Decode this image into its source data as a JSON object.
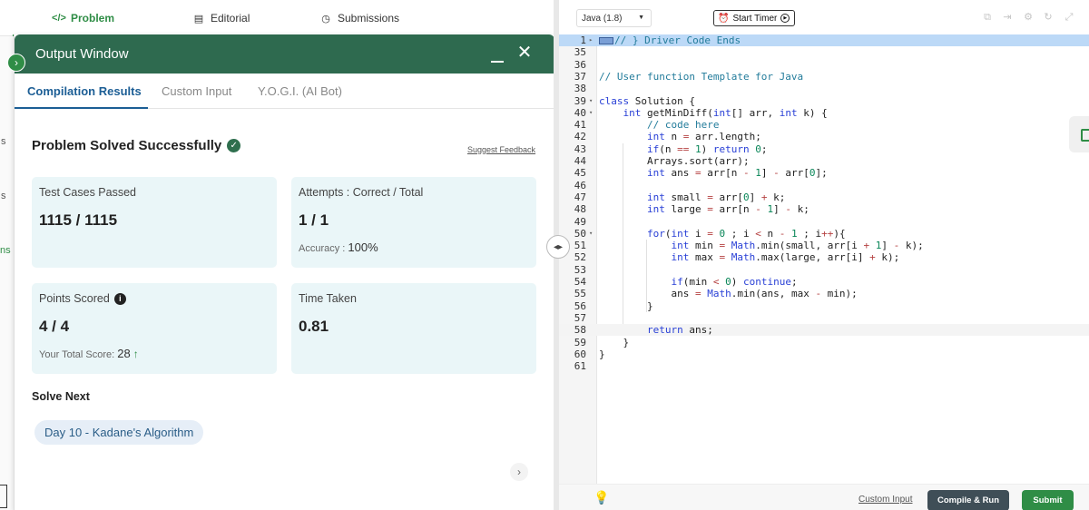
{
  "top_tabs": {
    "problem": "Problem",
    "editorial": "Editorial",
    "submissions": "Submissions"
  },
  "background_fragments": [
    "s",
    "s",
    "ns"
  ],
  "output_window": {
    "title": "Output Window",
    "tabs": [
      "Compilation Results",
      "Custom Input",
      "Y.O.G.I. (AI Bot)"
    ],
    "status": "Problem Solved Successfully",
    "suggest_feedback": "Suggest Feedback",
    "cards": {
      "test_cases": {
        "label": "Test Cases Passed",
        "value": "1115 / 1115"
      },
      "attempts": {
        "label": "Attempts : Correct / Total",
        "value": "1 / 1",
        "sub_label": "Accuracy :",
        "sub_value": "100%"
      },
      "points": {
        "label": "Points Scored",
        "value": "4 / 4",
        "sub_label": "Your Total Score:",
        "sub_value": "28"
      },
      "time": {
        "label": "Time Taken",
        "value": "0.81"
      }
    },
    "solve_next_heading": "Solve Next",
    "solve_next_item": "Day 10 - Kadane's Algorithm"
  },
  "editor": {
    "language": "Java (1.8)",
    "timer_label": "Start Timer",
    "lines": [
      {
        "n": "1",
        "fold": true,
        "text": "// } Driver Code Ends"
      },
      {
        "n": "35",
        "fold": false,
        "text": ""
      },
      {
        "n": "36",
        "fold": false,
        "text": ""
      },
      {
        "n": "37",
        "fold": false,
        "text": "// User function Template for Java"
      },
      {
        "n": "38",
        "fold": false,
        "text": ""
      },
      {
        "n": "39",
        "fold": true,
        "text": "class Solution {"
      },
      {
        "n": "40",
        "fold": true,
        "text": "    int getMinDiff(int[] arr, int k) {"
      },
      {
        "n": "41",
        "fold": false,
        "text": "        // code here"
      },
      {
        "n": "42",
        "fold": false,
        "text": "        int n = arr.length;"
      },
      {
        "n": "43",
        "fold": false,
        "text": "        if(n == 1) return 0;"
      },
      {
        "n": "44",
        "fold": false,
        "text": "        Arrays.sort(arr);"
      },
      {
        "n": "45",
        "fold": false,
        "text": "        int ans = arr[n - 1] - arr[0];"
      },
      {
        "n": "46",
        "fold": false,
        "text": ""
      },
      {
        "n": "47",
        "fold": false,
        "text": "        int small = arr[0] + k;"
      },
      {
        "n": "48",
        "fold": false,
        "text": "        int large = arr[n - 1] - k;"
      },
      {
        "n": "49",
        "fold": false,
        "text": ""
      },
      {
        "n": "50",
        "fold": true,
        "text": "        for(int i = 0 ; i < n - 1 ; i++){"
      },
      {
        "n": "51",
        "fold": false,
        "text": "            int min = Math.min(small, arr[i + 1] - k);"
      },
      {
        "n": "52",
        "fold": false,
        "text": "            int max = Math.max(large, arr[i] + k);"
      },
      {
        "n": "53",
        "fold": false,
        "text": ""
      },
      {
        "n": "54",
        "fold": false,
        "text": "            if(min < 0) continue;"
      },
      {
        "n": "55",
        "fold": false,
        "text": "            ans = Math.min(ans, max - min);"
      },
      {
        "n": "56",
        "fold": false,
        "text": "        }"
      },
      {
        "n": "57",
        "fold": false,
        "text": ""
      },
      {
        "n": "58",
        "fold": false,
        "text": "        return ans;"
      },
      {
        "n": "59",
        "fold": false,
        "text": "    }"
      },
      {
        "n": "60",
        "fold": false,
        "text": "}"
      },
      {
        "n": "61",
        "fold": false,
        "text": ""
      }
    ]
  },
  "footer": {
    "custom_input": "Custom Input",
    "compile_run": "Compile & Run",
    "submit": "Submit"
  },
  "colors": {
    "brand_green": "#2f8d46",
    "output_header": "#2e6a4f",
    "accent_blue": "#1c5e95",
    "card_bg": "#eaf6f8",
    "compile_btn": "#3f4e57"
  }
}
